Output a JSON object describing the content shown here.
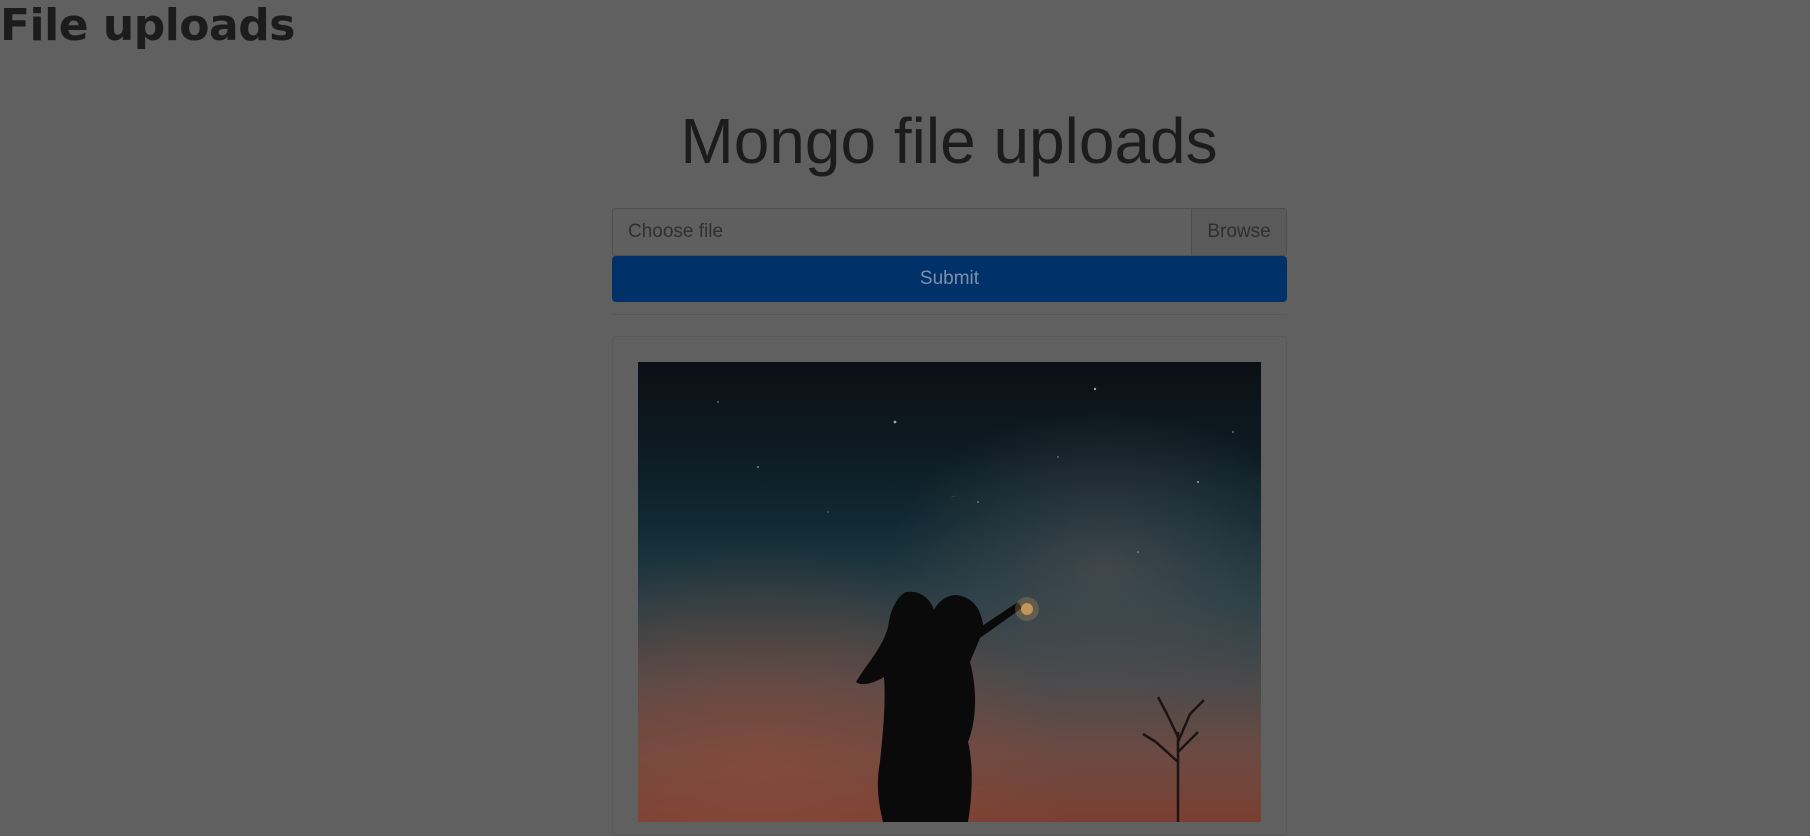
{
  "page": {
    "heading": "File uploads",
    "title": "Mongo file uploads"
  },
  "upload_form": {
    "file_label": "Choose file",
    "browse_label": "Browse",
    "submit_label": "Submit"
  },
  "colors": {
    "overlay_background": "#606060",
    "submit_button": "#003169"
  },
  "uploaded_files": [
    {
      "description": "image",
      "icon": "uploaded-image"
    }
  ]
}
